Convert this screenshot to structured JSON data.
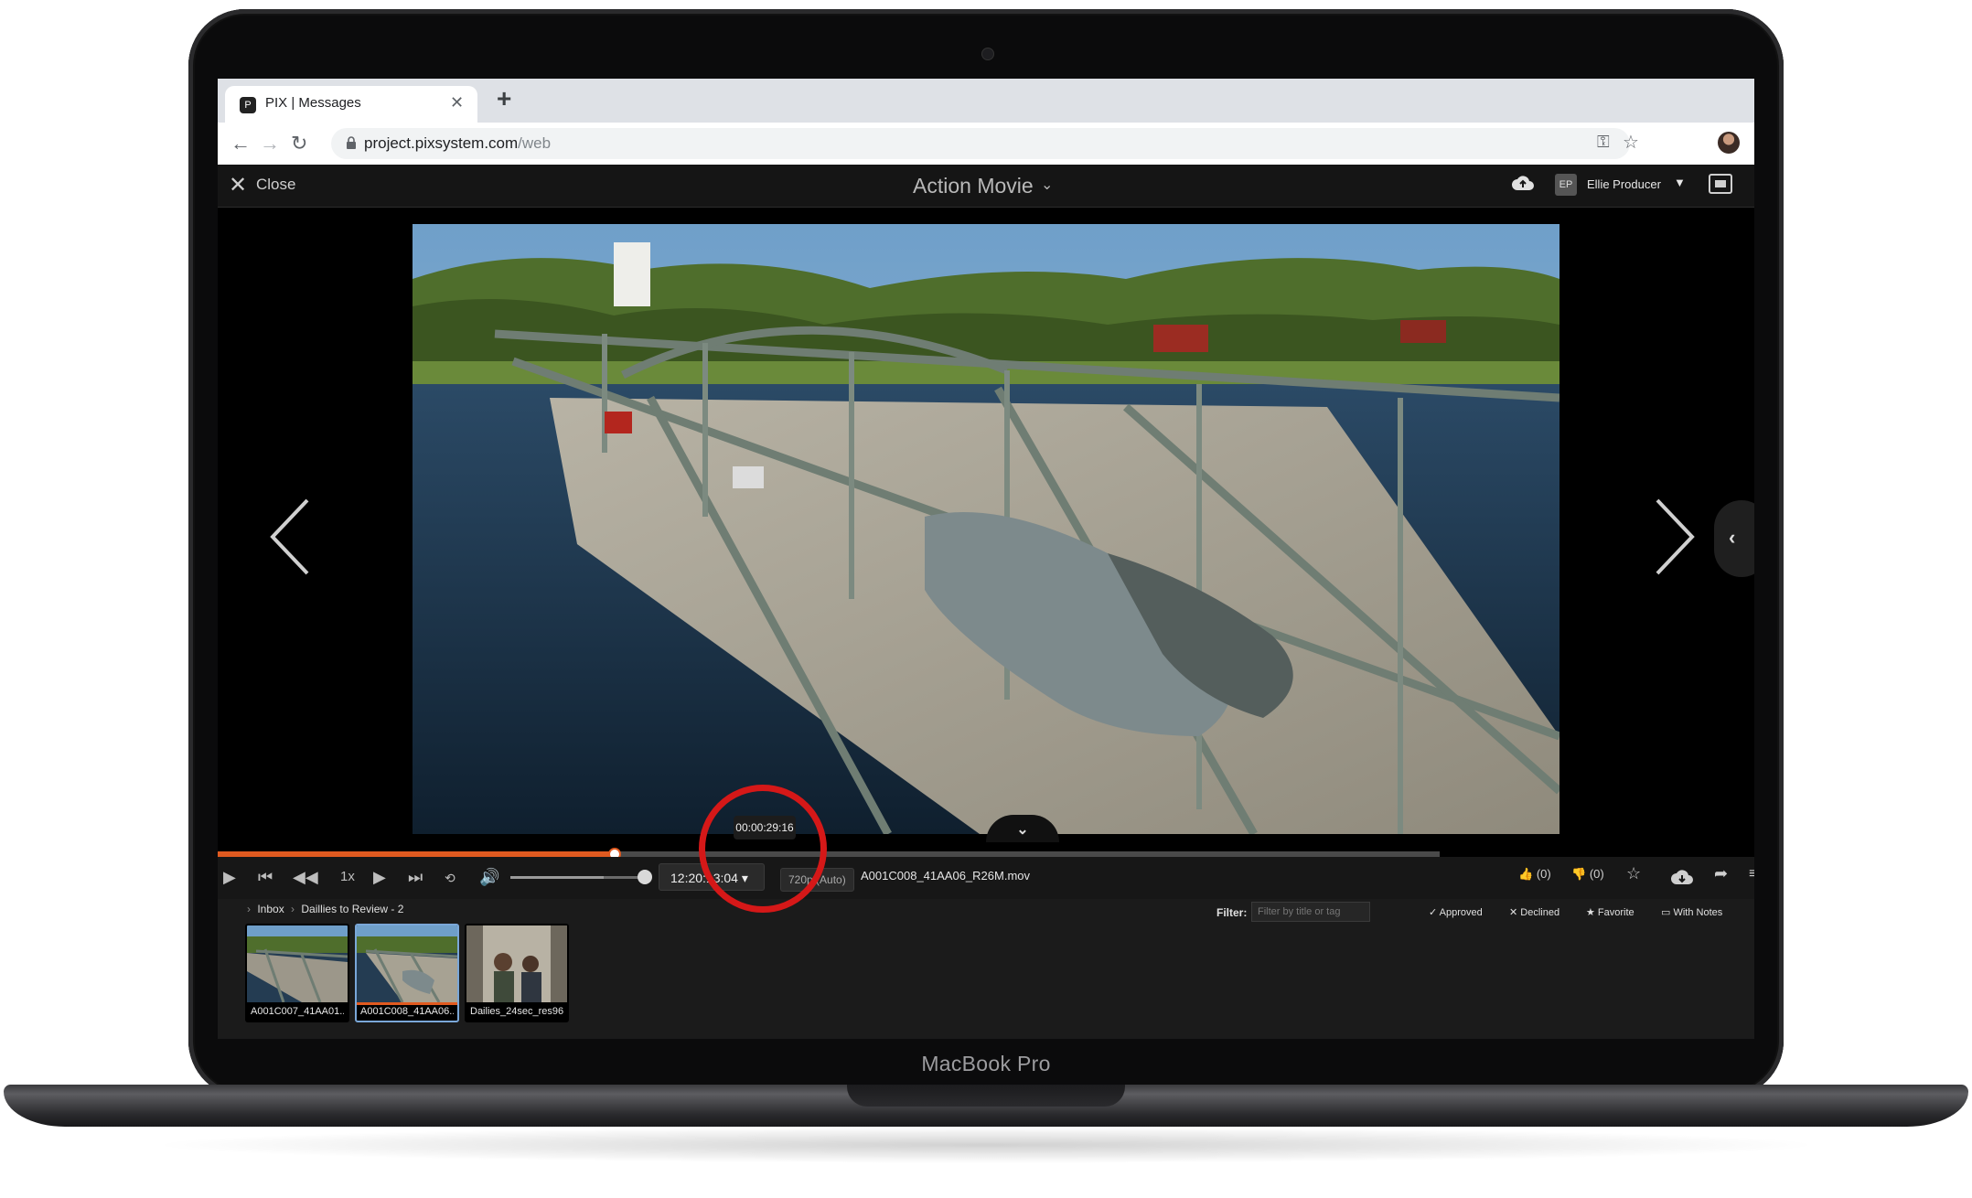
{
  "device": {
    "label": "MacBook Pro"
  },
  "browser": {
    "tab": {
      "title": "PIX | Messages",
      "close_glyph": "✕",
      "favicon": "P"
    },
    "new_tab_glyph": "+",
    "url": {
      "host": "project.pixsystem.com",
      "path": "/web"
    },
    "icons": [
      "back-arrow-icon",
      "forward-arrow-icon",
      "reload-icon",
      "lock-icon",
      "key-icon",
      "star-icon"
    ]
  },
  "app_header": {
    "close_label": "Close",
    "project_title": "Action Movie",
    "user": {
      "initials": "EP",
      "name": "Ellie Producer"
    }
  },
  "player": {
    "tooltip_time": "00:00:29:16",
    "progress": 0.325,
    "buffered": 0.795,
    "speed": "1x",
    "volume": 0.7,
    "timecode": "12:20:13:04",
    "quality": "720p (Auto)",
    "filename": "A001C008_41AA06_R26M.mov",
    "likes": "(0)",
    "dislikes": "(0)"
  },
  "panel": {
    "breadcrumb": [
      "Inbox",
      "Daillies to Review - 2"
    ],
    "filter_label": "Filter:",
    "filter_placeholder": "Filter by title or tag",
    "filters": [
      "Approved",
      "Declined",
      "Favorite",
      "With Notes"
    ],
    "thumbnails": [
      {
        "label": "A001C007_41AA01...",
        "selected": false
      },
      {
        "label": "A001C008_41AA06...",
        "selected": true
      },
      {
        "label": "Dailies_24sec_res96...",
        "selected": false
      }
    ]
  },
  "colors": {
    "accent": "#e05a20",
    "annotation": "#d51818",
    "selection": "#7aa7d8"
  }
}
